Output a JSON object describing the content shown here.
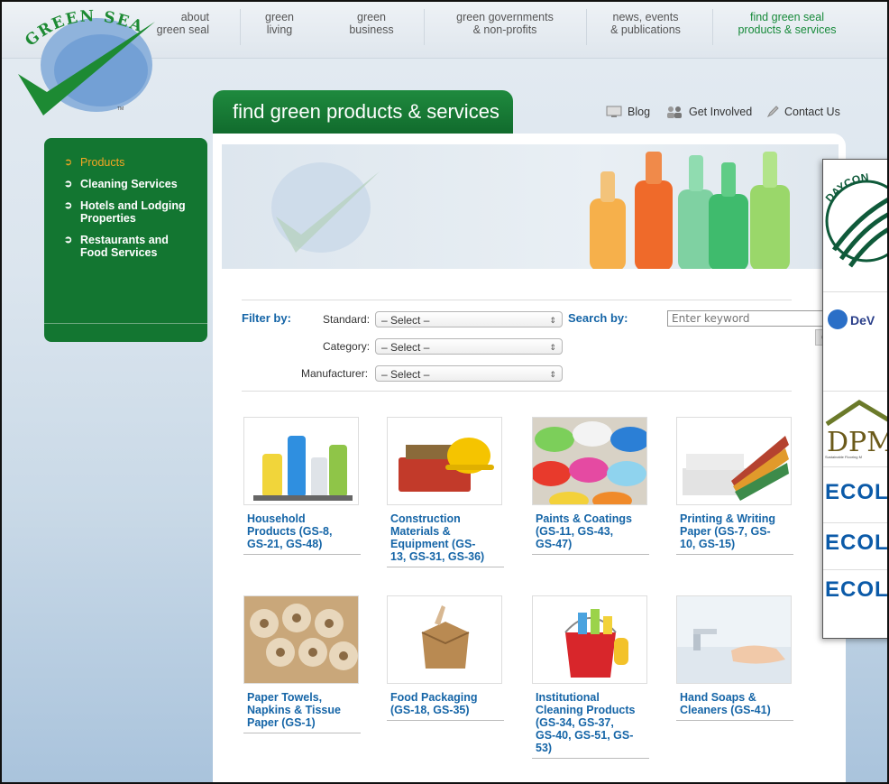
{
  "logo": {
    "text": "GREEN SEAL",
    "tm": "TM"
  },
  "topnav": [
    {
      "line1": "about",
      "line2": "green seal"
    },
    {
      "line1": "green",
      "line2": "living"
    },
    {
      "line1": "green",
      "line2": "business"
    },
    {
      "line1": "green governments",
      "line2": "& non-profits"
    },
    {
      "line1": "news, events",
      "line2": "& publications"
    },
    {
      "line1": "find green seal",
      "line2": "products & services"
    }
  ],
  "page_title": "find green products & services",
  "utility": {
    "blog": "Blog",
    "get_involved": "Get Involved",
    "contact": "Contact Us"
  },
  "leftnav": [
    {
      "label": "Products"
    },
    {
      "label": "Cleaning Services"
    },
    {
      "label": "Hotels and Lodging Properties"
    },
    {
      "label": "Restaurants and Food Services"
    }
  ],
  "filters": {
    "filter_by": "Filter by:",
    "standard_label": "Standard:",
    "category_label": "Category:",
    "manufacturer_label": "Manufacturer:",
    "select_value": "– Select –",
    "search_by": "Search by:",
    "search_placeholder": "Enter keyword",
    "go": "Go"
  },
  "products": [
    {
      "line1": "Household",
      "line2": "Products (GS-8,",
      "line3": "GS-21, GS-48)",
      "line4": "",
      "line5": ""
    },
    {
      "line1": "Construction",
      "line2": "Materials &",
      "line3": "Equipment (GS-",
      "line4": "13, GS-31, GS-36)",
      "line5": ""
    },
    {
      "line1": "Paints & Coatings",
      "line2": "(GS-11, GS-43,",
      "line3": "GS-47)",
      "line4": "",
      "line5": ""
    },
    {
      "line1": "Printing & Writing",
      "line2": "Paper (GS-7, GS-",
      "line3": "10, GS-15)",
      "line4": "",
      "line5": ""
    },
    {
      "line1": "Paper Towels,",
      "line2": "Napkins & Tissue",
      "line3": "Paper (GS-1)",
      "line4": "",
      "line5": ""
    },
    {
      "line1": "Food Packaging",
      "line2": "(GS-18, GS-35)",
      "line3": "",
      "line4": "",
      "line5": ""
    },
    {
      "line1": "Institutional",
      "line2": "Cleaning Products",
      "line3": "(GS-34, GS-37,",
      "line4": "GS-40, GS-51, GS-",
      "line5": "53)"
    },
    {
      "line1": "Hand Soaps &",
      "line2": "Cleaners (GS-41)",
      "line3": "",
      "line4": "",
      "line5": ""
    }
  ],
  "overlay": {
    "daycon": "DAYCON",
    "devere": "DeV",
    "dpm": "DPM",
    "dpm_sub": "Sustainable Flooring M",
    "ecolab": [
      "ECOLA",
      "ECOLA",
      "ECOLA"
    ]
  },
  "colors": {
    "brand_green": "#137631",
    "link_blue": "#1565a7",
    "active_orange": "#f5a623"
  }
}
